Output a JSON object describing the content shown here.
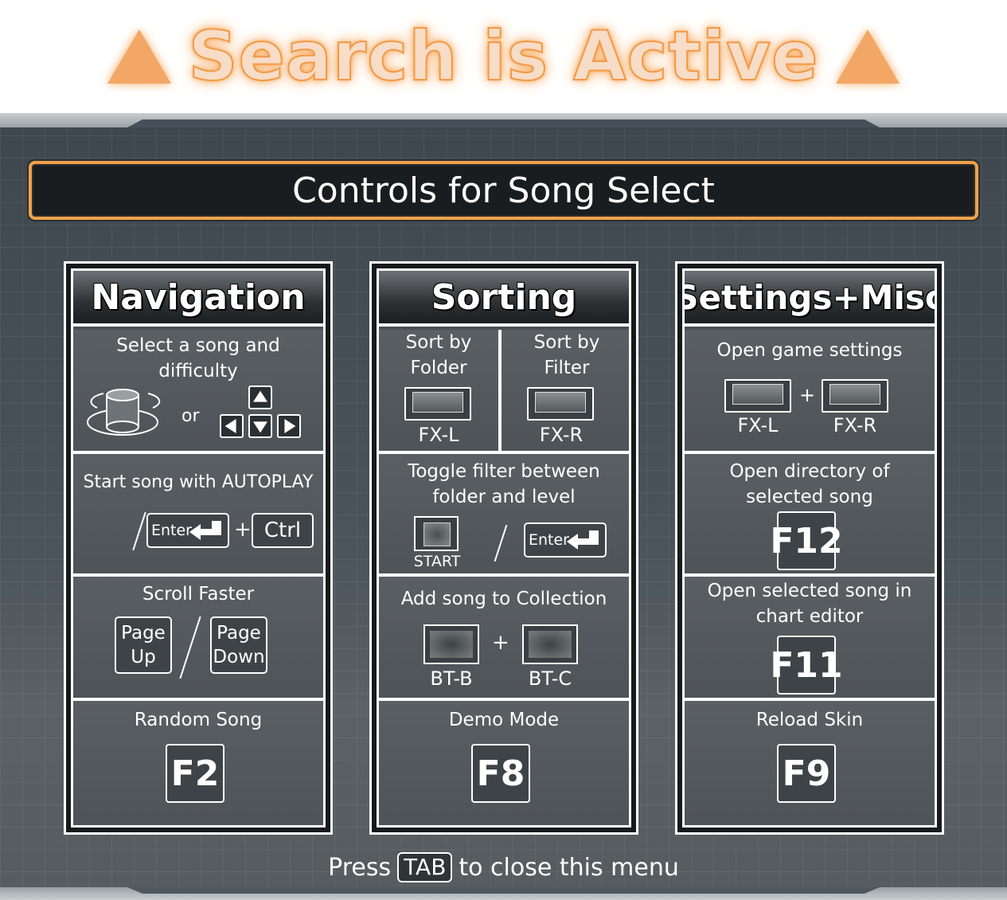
{
  "banner": {
    "text": "Search is Active",
    "accent": "#f29a46"
  },
  "menu": {
    "title": "Controls for Song Select"
  },
  "navigation": {
    "title": "Navigation",
    "select": {
      "label": "Select a song and difficulty",
      "or": "or"
    },
    "autoplay": {
      "label": "Start song with AUTOPLAY",
      "enter": "Enter",
      "plus": "+",
      "ctrl": "Ctrl"
    },
    "scroll": {
      "label": "Scroll Faster",
      "page_up": "Page Up",
      "page_down": "Page Down"
    },
    "random": {
      "label": "Random Song",
      "key": "F2"
    }
  },
  "sorting": {
    "title": "Sorting",
    "sort_folder": {
      "label": "Sort by Folder",
      "button": "FX-L"
    },
    "sort_filter": {
      "label": "Sort by Filter",
      "button": "FX-R"
    },
    "toggle": {
      "label": "Toggle filter between folder and level",
      "start": "START",
      "enter": "Enter"
    },
    "collection": {
      "label": "Add song to Collection",
      "plus": "+",
      "btn1": "BT-B",
      "btn2": "BT-C"
    },
    "demo": {
      "label": "Demo Mode",
      "key": "F8"
    }
  },
  "settings": {
    "title": "Settings+Misc",
    "game_settings": {
      "label": "Open game settings",
      "btn1": "FX-L",
      "plus": "+",
      "btn2": "FX-R"
    },
    "directory": {
      "label": "Open directory of selected song",
      "key": "F12"
    },
    "editor": {
      "label": "Open selected song in chart editor",
      "key": "F11"
    },
    "reload": {
      "label": "Reload Skin",
      "key": "F9"
    }
  },
  "footer": {
    "press": "Press",
    "key": "TAB",
    "rest": "to close this menu"
  }
}
